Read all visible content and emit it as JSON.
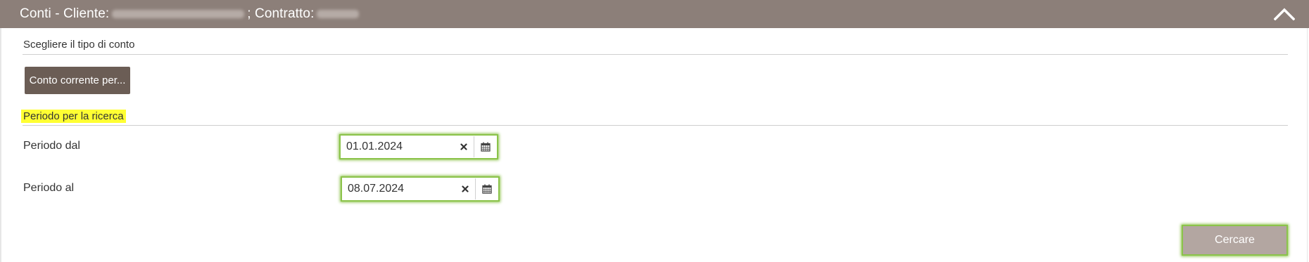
{
  "header": {
    "title_prefix": "Conti - Cliente:",
    "title_middle": "; Contratto:",
    "collapse_icon": "chevron-up-icon"
  },
  "account_type": {
    "section_label": "Scegliere il tipo di conto",
    "button_label": "Conto corrente per..."
  },
  "search_period": {
    "section_label": "Periodo per la ricerca",
    "from_label": "Periodo dal",
    "from_value": "01.01.2024",
    "to_label": "Periodo al",
    "to_value": "08.07.2024",
    "clear_icon": "close-icon",
    "calendar_icon": "calendar-icon"
  },
  "actions": {
    "search_label": "Cercare"
  },
  "colors": {
    "header_bg": "#8c7f79",
    "primary_button": "#6b5d55",
    "search_button": "#b3a6a1",
    "focus_outline": "#8bc34a",
    "highlight": "#ffff33"
  }
}
